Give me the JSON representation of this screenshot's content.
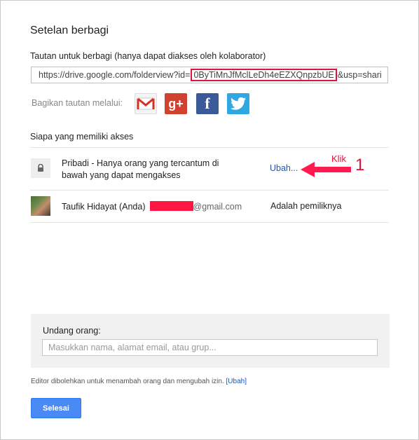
{
  "dialog": {
    "title": "Setelan berbagi",
    "link_label": "Tautan untuk berbagi (hanya dapat diakses oleh kolaborator)",
    "link": {
      "prefix": "https://drive.google.com/folderview?id=",
      "highlighted_id": "0ByTiMnJfMclLeDh4eEZXQnpzbUE",
      "suffix": "&usp=shari"
    },
    "share_via_label": "Bagikan tautan melalui:",
    "share_icons": [
      {
        "name": "gmail-icon",
        "glyph": "M",
        "color": "#d93025"
      },
      {
        "name": "google-plus-icon",
        "glyph": "g+",
        "color": "#d1412f"
      },
      {
        "name": "facebook-icon",
        "glyph": "f",
        "color": "#3b5998"
      },
      {
        "name": "twitter-icon",
        "glyph": "t",
        "color": "#2fa7e3"
      }
    ],
    "access_title": "Siapa yang memiliki akses",
    "access_rows": [
      {
        "icon": "lock-icon",
        "description": "Pribadi - Hanya orang yang tercantum di bawah yang dapat mengakses",
        "action": "Ubah..."
      },
      {
        "name": "Taufik Hidayat (Anda)",
        "email_domain": "@gmail.com",
        "role": "Adalah pemiliknya"
      }
    ],
    "annotation": {
      "text": "Klik",
      "number": "1",
      "color": "#e0123c"
    },
    "invite": {
      "label": "Undang orang:",
      "placeholder": "Masukkan nama, alamat email, atau grup..."
    },
    "footer": {
      "note": "Editor dibolehkan untuk menambah orang dan mengubah izin.",
      "change_link": "[Ubah]"
    },
    "done_button": "Selesai"
  },
  "colors": {
    "accent_blue": "#4a8af4",
    "link_blue": "#1a55b5",
    "annotation_red": "#e0123c"
  }
}
